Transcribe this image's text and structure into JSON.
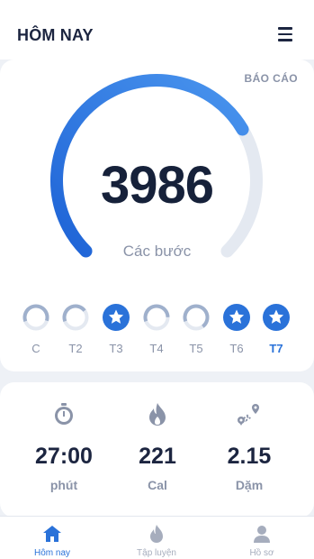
{
  "header": {
    "title": "HÔM NAY"
  },
  "report": {
    "label": "BÁO CÁO"
  },
  "steps": {
    "value": "3986",
    "label": "Các bước",
    "progress": 0.72
  },
  "week": [
    {
      "label": "C",
      "progress": 0.6,
      "complete": false,
      "current": false
    },
    {
      "label": "T2",
      "progress": 0.45,
      "complete": false,
      "current": false
    },
    {
      "label": "T3",
      "progress": 1,
      "complete": true,
      "current": false
    },
    {
      "label": "T4",
      "progress": 0.55,
      "complete": false,
      "current": false
    },
    {
      "label": "T5",
      "progress": 0.7,
      "complete": false,
      "current": false
    },
    {
      "label": "T6",
      "progress": 1,
      "complete": true,
      "current": false
    },
    {
      "label": "T7",
      "progress": 1,
      "complete": true,
      "current": true
    }
  ],
  "stats": {
    "time": {
      "value": "27:00",
      "unit": "phút",
      "icon": "stopwatch-icon"
    },
    "calories": {
      "value": "221",
      "unit": "Cal",
      "icon": "flame-icon"
    },
    "distance": {
      "value": "2.15",
      "unit": "Dặm",
      "icon": "route-icon"
    }
  },
  "nav": {
    "home": {
      "label": "Hôm nay",
      "icon": "home-icon"
    },
    "workout": {
      "label": "Tập luyện",
      "icon": "flame-icon"
    },
    "profile": {
      "label": "Hồ sơ",
      "icon": "user-icon"
    }
  },
  "colors": {
    "accent": "#2a72d9",
    "track": "#e4e9f1",
    "text": "#1c2540",
    "muted": "#8a93a8"
  }
}
